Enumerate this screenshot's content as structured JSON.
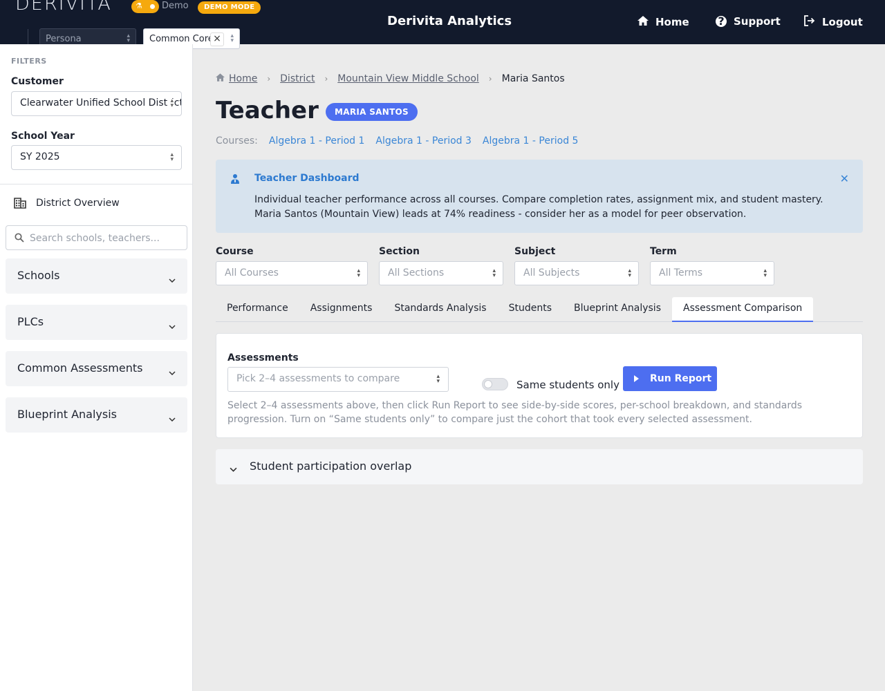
{
  "header": {
    "logo": "DERIVITA",
    "demo_label": "Demo",
    "demo_badge": "DEMO MODE",
    "persona_placeholder": "Persona",
    "standard_value": "Common Core",
    "app_title": "Derivita Analytics",
    "nav": {
      "home": "Home",
      "support": "Support",
      "logout": "Logout"
    }
  },
  "sidebar": {
    "filters_title": "FILTERS",
    "customer_label": "Customer",
    "customer_value": "Clearwater Unified School District",
    "school_year_label": "School Year",
    "school_year_value": "SY 2025",
    "district_overview": "District Overview",
    "search_placeholder": "Search schools, teachers...",
    "sections": [
      "Schools",
      "PLCs",
      "Common Assessments",
      "Blueprint Analysis"
    ]
  },
  "breadcrumb": {
    "home": "Home",
    "district": "District",
    "school": "Mountain View Middle School",
    "current": "Maria Santos"
  },
  "page": {
    "title": "Teacher",
    "teacher_badge": "MARIA SANTOS",
    "courses_label": "Courses:",
    "courses": [
      "Algebra 1 - Period 1",
      "Algebra 1 - Period 3",
      "Algebra 1 - Period 5"
    ]
  },
  "alert": {
    "title": "Teacher Dashboard",
    "line1": "Individual teacher performance across all courses. Compare completion rates, assignment mix, and student mastery.",
    "line2": "Maria Santos (Mountain View) leads at 74% readiness - consider her as a model for peer observation."
  },
  "filters": {
    "course": {
      "label": "Course",
      "value": "All Courses"
    },
    "section": {
      "label": "Section",
      "value": "All Sections"
    },
    "subject": {
      "label": "Subject",
      "value": "All Subjects"
    },
    "term": {
      "label": "Term",
      "value": "All Terms"
    }
  },
  "tabs": [
    "Performance",
    "Assignments",
    "Standards Analysis",
    "Students",
    "Blueprint Analysis",
    "Assessment Comparison"
  ],
  "active_tab": "Assessment Comparison",
  "report": {
    "assessments_label": "Assessments",
    "assessments_placeholder": "Pick 2–4 assessments to compare",
    "same_students_label": "Same students only",
    "same_students_on": false,
    "run_button": "Run Report",
    "help_line1": "Select 2–4 assessments above, then click Run Report to see side-by-side scores, per-school breakdown, and standards",
    "help_line2": "progression. Turn on “Same students only” to compare just the cohort that took every selected assessment."
  },
  "overlap": {
    "title": "Student participation overlap"
  },
  "colors": {
    "header_bg": "#121a2c",
    "accent": "#4d6ef0",
    "demo": "#f5a90e",
    "link": "#3a86d6",
    "alert_bg": "#d7e3ee"
  }
}
